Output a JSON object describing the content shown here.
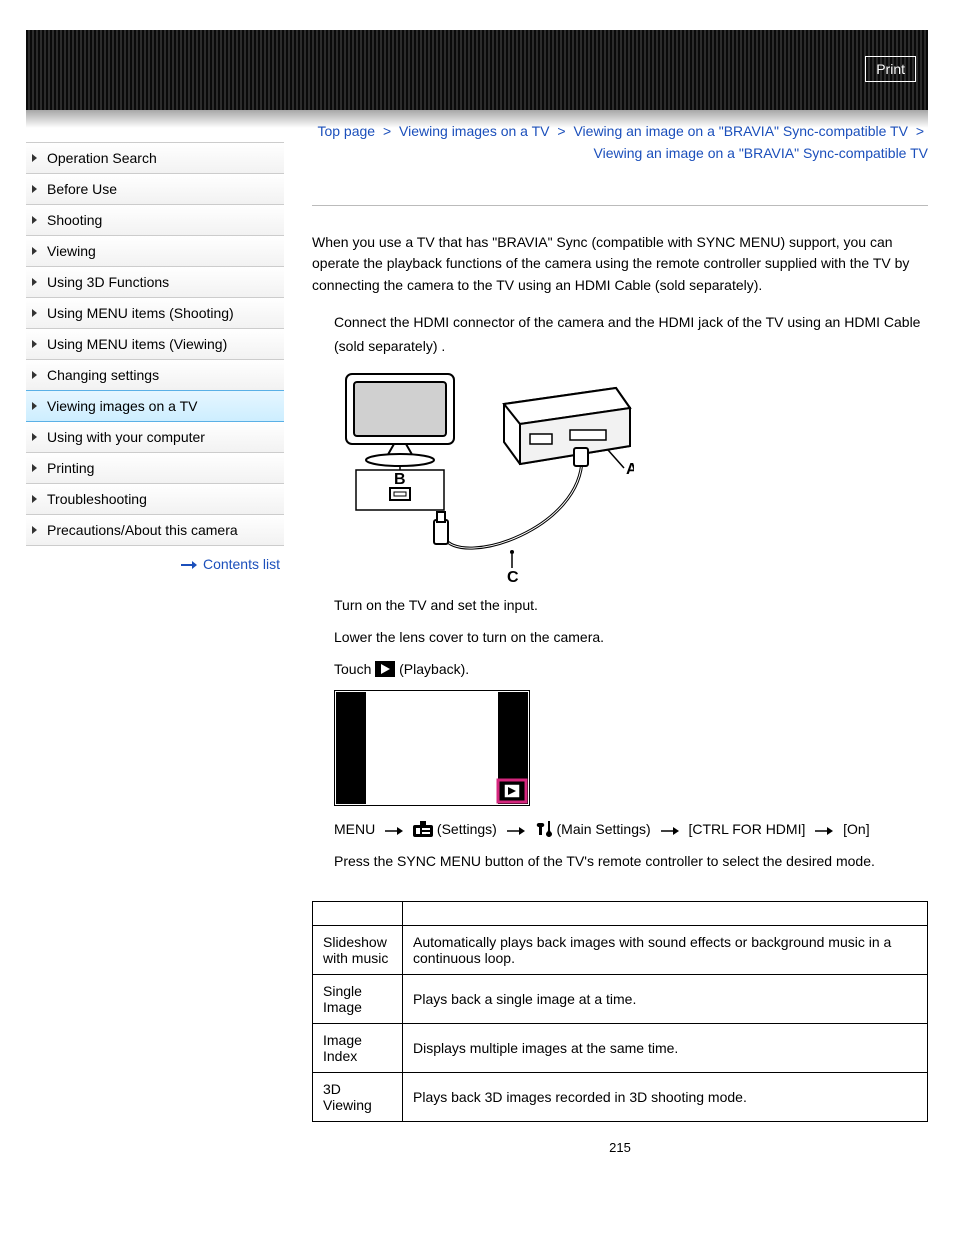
{
  "topbar": {
    "print": "Print"
  },
  "sidebar": {
    "items": [
      {
        "label": "Operation Search"
      },
      {
        "label": "Before Use"
      },
      {
        "label": "Shooting"
      },
      {
        "label": "Viewing"
      },
      {
        "label": "Using 3D Functions"
      },
      {
        "label": "Using MENU items (Shooting)"
      },
      {
        "label": "Using MENU items (Viewing)"
      },
      {
        "label": "Changing settings"
      },
      {
        "label": "Viewing images on a TV"
      },
      {
        "label": "Using with your computer"
      },
      {
        "label": "Printing"
      },
      {
        "label": "Troubleshooting"
      },
      {
        "label": "Precautions/About this camera"
      }
    ],
    "active_index": 8,
    "contents_link": "Contents list"
  },
  "breadcrumb": {
    "seg1": "Top page",
    "seg2": "Viewing images on a TV",
    "seg3": "Viewing an image on a \"BRAVIA\" Sync-compatible TV",
    "seg4": "Viewing an image on a \"BRAVIA\" Sync-compatible TV",
    "sep": ">"
  },
  "body": {
    "intro": "When you use a TV that has \"BRAVIA\" Sync (compatible with SYNC MENU) support, you can operate the playback functions of the camera using the remote controller supplied with the TV by connecting the camera to the TV using an HDMI Cable (sold separately).",
    "step1": "Connect the HDMI connector of the camera      and the HDMI jack of the TV      using an HDMI Cable (sold separately)     .",
    "step2": "Turn on the TV and set the input.",
    "step3": "Lower the lens cover to turn on the camera.",
    "step4_pre": "Touch ",
    "step4_post": "(Playback).",
    "menu_pre": "MENU",
    "menu_settings": "(Settings)",
    "menu_main": "(Main Settings)",
    "menu_ctrl": "[CTRL FOR HDMI]",
    "menu_on": "[On]",
    "step5": "Press the SYNC MENU button of the TV's remote controller to select the desired mode."
  },
  "illus": {
    "label_a": "A",
    "label_b": "B",
    "label_c": "C"
  },
  "table": {
    "rows": [
      {
        "name": "Slideshow with music",
        "desc": "Automatically plays back images with sound effects or background music in a continuous loop."
      },
      {
        "name": "Single Image",
        "desc": "Plays back a single image at a time."
      },
      {
        "name": "Image Index",
        "desc": "Displays multiple images at the same time."
      },
      {
        "name": "3D Viewing",
        "desc": "Plays back 3D images recorded in 3D shooting mode."
      }
    ]
  },
  "page_number": "215"
}
